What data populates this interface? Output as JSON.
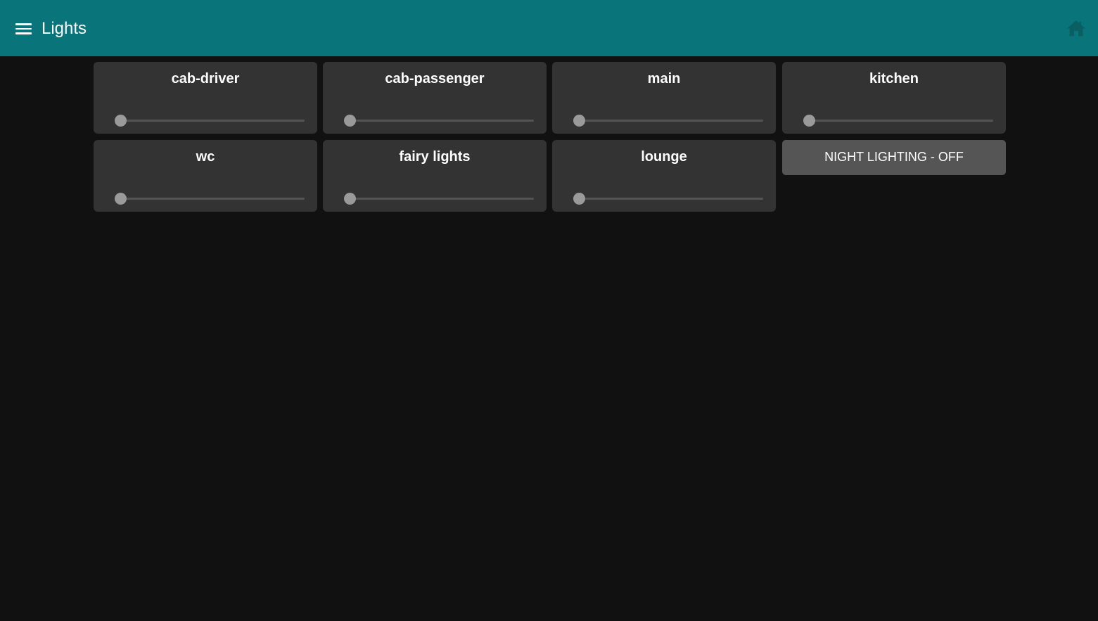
{
  "header": {
    "title": "Lights",
    "menu_icon": "hamburger-menu-icon",
    "home_icon": "home-icon"
  },
  "colors": {
    "header_bg": "#097479",
    "page_bg": "#111111",
    "card_bg": "#333333",
    "button_bg": "#555555",
    "slider_thumb": "#9a9a9a",
    "slider_track": "#545454"
  },
  "lights": [
    {
      "label": "cab-driver",
      "level": 0
    },
    {
      "label": "cab-passenger",
      "level": 0
    },
    {
      "label": "main",
      "level": 0
    },
    {
      "label": "kitchen",
      "level": 0
    },
    {
      "label": "wc",
      "level": 0
    },
    {
      "label": "fairy lights",
      "level": 0
    },
    {
      "label": "lounge",
      "level": 0
    }
  ],
  "night_button": {
    "label": "NIGHT LIGHTING - OFF"
  }
}
